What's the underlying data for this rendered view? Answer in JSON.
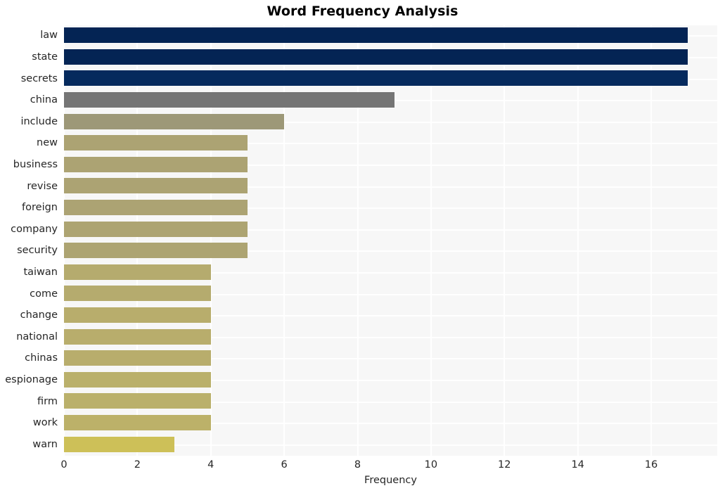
{
  "chart_data": {
    "type": "bar",
    "orientation": "horizontal",
    "title": "Word Frequency Analysis",
    "xlabel": "Frequency",
    "ylabel": "",
    "categories": [
      "law",
      "state",
      "secrets",
      "china",
      "include",
      "new",
      "business",
      "revise",
      "foreign",
      "company",
      "security",
      "taiwan",
      "come",
      "change",
      "national",
      "chinas",
      "espionage",
      "firm",
      "work",
      "warn"
    ],
    "values": [
      17,
      17,
      17,
      9,
      6,
      5,
      5,
      5,
      5,
      5,
      5,
      4,
      4,
      4,
      4,
      4,
      4,
      4,
      4,
      3
    ],
    "bar_colors": [
      "#042454",
      "#042454",
      "#052a5d",
      "#757575",
      "#9d9878",
      "#aca373",
      "#aca373",
      "#aca373",
      "#aca373",
      "#ada472",
      "#ada472",
      "#b5ab6e",
      "#b5ab6e",
      "#b8ad6c",
      "#b8ad6c",
      "#b8ad6c",
      "#bab06b",
      "#bab06b",
      "#bcb169",
      "#cdc058"
    ],
    "xlim": [
      0,
      17.8
    ],
    "xticks": [
      0,
      2,
      4,
      6,
      8,
      10,
      12,
      14,
      16
    ],
    "xtick_labels": [
      "0",
      "2",
      "4",
      "6",
      "8",
      "10",
      "12",
      "14",
      "16"
    ],
    "grid": true,
    "grid_color": "#ffffff",
    "plot_background": "#f7f7f7",
    "figure_background": "#ffffff",
    "legend": null
  }
}
